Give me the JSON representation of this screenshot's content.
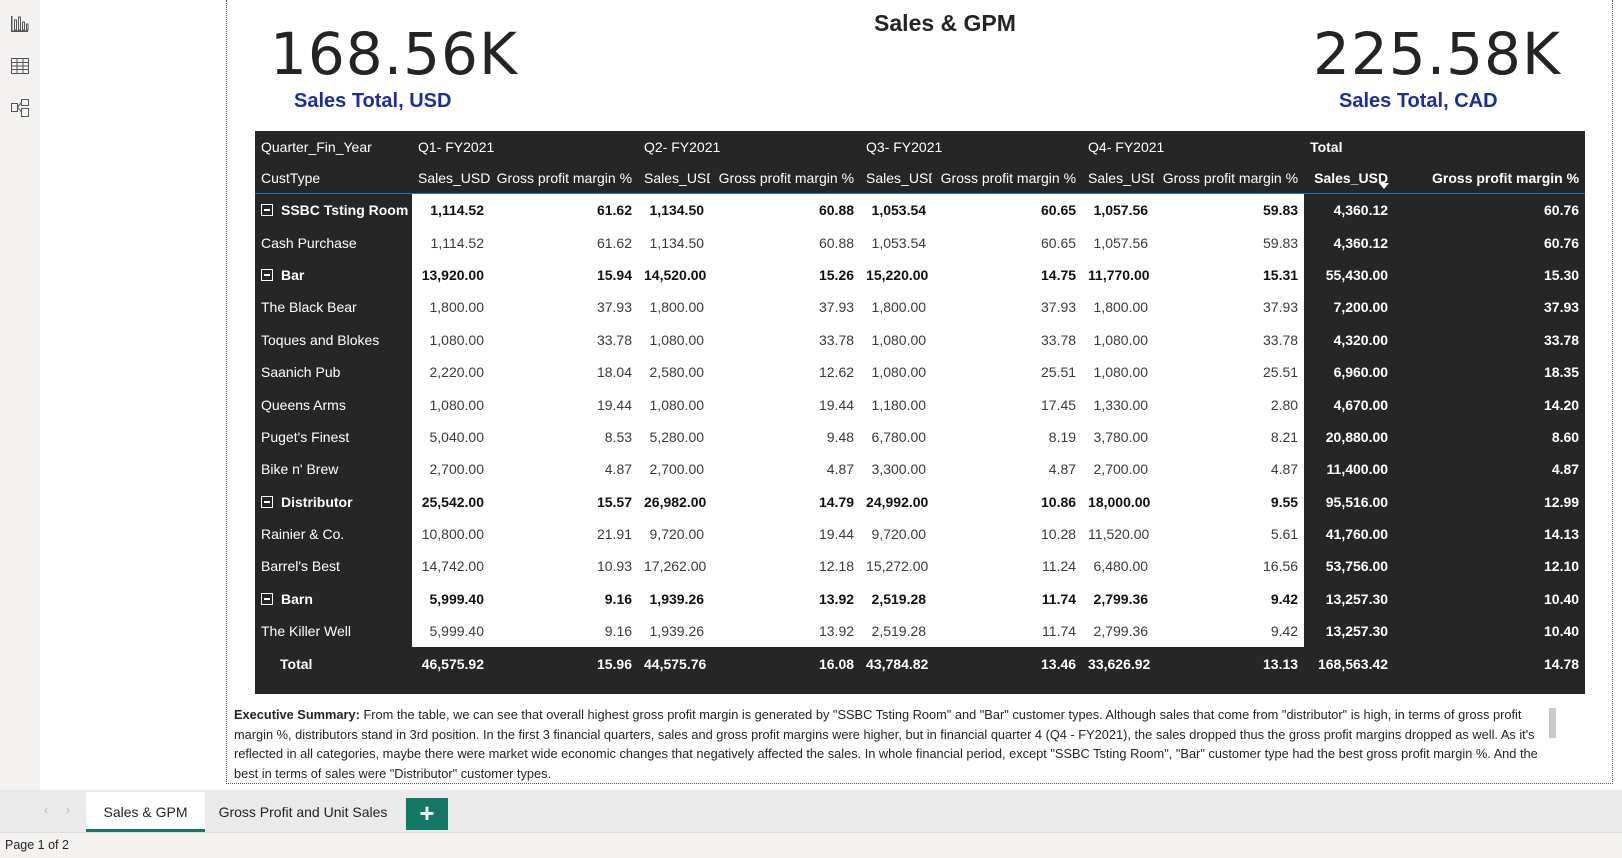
{
  "report": {
    "title": "Sales & GPM",
    "kpi_left": {
      "value": "168.56K",
      "label": "Sales Total, USD"
    },
    "kpi_right": {
      "value": "225.58K",
      "label": "Sales Total, CAD"
    }
  },
  "matrix": {
    "header_row1": {
      "corner": "Quarter_Fin_Year",
      "q1": "Q1- FY2021",
      "q2": "Q2- FY2021",
      "q3": "Q3- FY2021",
      "q4": "Q4- FY2021",
      "total": "Total"
    },
    "header_row2": {
      "corner": "CustType",
      "col_sales": "Sales_USD",
      "col_gpm": "Gross profit margin %"
    },
    "rows": [
      {
        "label": "SSBC Tsting Room",
        "level": "group",
        "vals": [
          "1,114.52",
          "61.62",
          "1,134.50",
          "60.88",
          "1,053.54",
          "60.65",
          "1,057.56",
          "59.83"
        ],
        "total": [
          "4,360.12",
          "60.76"
        ]
      },
      {
        "label": "Cash Purchase",
        "level": "child",
        "vals": [
          "1,114.52",
          "61.62",
          "1,134.50",
          "60.88",
          "1,053.54",
          "60.65",
          "1,057.56",
          "59.83"
        ],
        "total": [
          "4,360.12",
          "60.76"
        ]
      },
      {
        "label": "Bar",
        "level": "group",
        "vals": [
          "13,920.00",
          "15.94",
          "14,520.00",
          "15.26",
          "15,220.00",
          "14.75",
          "11,770.00",
          "15.31"
        ],
        "total": [
          "55,430.00",
          "15.30"
        ]
      },
      {
        "label": "The Black Bear",
        "level": "child",
        "vals": [
          "1,800.00",
          "37.93",
          "1,800.00",
          "37.93",
          "1,800.00",
          "37.93",
          "1,800.00",
          "37.93"
        ],
        "total": [
          "7,200.00",
          "37.93"
        ]
      },
      {
        "label": "Toques and Blokes",
        "level": "child",
        "vals": [
          "1,080.00",
          "33.78",
          "1,080.00",
          "33.78",
          "1,080.00",
          "33.78",
          "1,080.00",
          "33.78"
        ],
        "total": [
          "4,320.00",
          "33.78"
        ]
      },
      {
        "label": "Saanich Pub",
        "level": "child",
        "vals": [
          "2,220.00",
          "18.04",
          "2,580.00",
          "12.62",
          "1,080.00",
          "25.51",
          "1,080.00",
          "25.51"
        ],
        "total": [
          "6,960.00",
          "18.35"
        ]
      },
      {
        "label": "Queens Arms",
        "level": "child",
        "vals": [
          "1,080.00",
          "19.44",
          "1,080.00",
          "19.44",
          "1,180.00",
          "17.45",
          "1,330.00",
          "2.80"
        ],
        "total": [
          "4,670.00",
          "14.20"
        ]
      },
      {
        "label": "Puget's Finest",
        "level": "child",
        "vals": [
          "5,040.00",
          "8.53",
          "5,280.00",
          "9.48",
          "6,780.00",
          "8.19",
          "3,780.00",
          "8.21"
        ],
        "total": [
          "20,880.00",
          "8.60"
        ]
      },
      {
        "label": "Bike n' Brew",
        "level": "child",
        "vals": [
          "2,700.00",
          "4.87",
          "2,700.00",
          "4.87",
          "3,300.00",
          "4.87",
          "2,700.00",
          "4.87"
        ],
        "total": [
          "11,400.00",
          "4.87"
        ]
      },
      {
        "label": "Distributor",
        "level": "group",
        "vals": [
          "25,542.00",
          "15.57",
          "26,982.00",
          "14.79",
          "24,992.00",
          "10.86",
          "18,000.00",
          "9.55"
        ],
        "total": [
          "95,516.00",
          "12.99"
        ]
      },
      {
        "label": "Rainier & Co.",
        "level": "child",
        "vals": [
          "10,800.00",
          "21.91",
          "9,720.00",
          "19.44",
          "9,720.00",
          "10.28",
          "11,520.00",
          "5.61"
        ],
        "total": [
          "41,760.00",
          "14.13"
        ]
      },
      {
        "label": "Barrel's Best",
        "level": "child",
        "vals": [
          "14,742.00",
          "10.93",
          "17,262.00",
          "12.18",
          "15,272.00",
          "11.24",
          "6,480.00",
          "16.56"
        ],
        "total": [
          "53,756.00",
          "12.10"
        ]
      },
      {
        "label": "Barn",
        "level": "group",
        "vals": [
          "5,999.40",
          "9.16",
          "1,939.26",
          "13.92",
          "2,519.28",
          "11.74",
          "2,799.36",
          "9.42"
        ],
        "total": [
          "13,257.30",
          "10.40"
        ]
      },
      {
        "label": "The Killer Well",
        "level": "child",
        "vals": [
          "5,999.40",
          "9.16",
          "1,939.26",
          "13.92",
          "2,519.28",
          "11.74",
          "2,799.36",
          "9.42"
        ],
        "total": [
          "13,257.30",
          "10.40"
        ]
      }
    ],
    "grand_total": {
      "label": "Total",
      "vals": [
        "46,575.92",
        "15.96",
        "44,575.76",
        "16.08",
        "43,784.82",
        "13.46",
        "33,626.92",
        "13.13"
      ],
      "total": [
        "168,563.42",
        "14.78"
      ]
    }
  },
  "summary": {
    "heading": "Executive Summary:",
    "text": "From the table, we can see that overall highest gross profit margin is generated by \"SSBC Tsting Room\"  and \"Bar\" customer types. Although sales that come from \"distributor\" is high, in terms of gross profit margin %, distributors stand in 3rd position. In the first 3 financial quarters, sales and gross profit margins were higher, but in financial quarter 4 (Q4 - FY2021), the sales dropped thus the gross profit margins dropped as well. As it's reflected in all categories, maybe there were market wide economic changes that negatively affected the sales. In whole financial period, except \"SSBC Tsting Room\", \"Bar\" customer type had the best gross profit margin %. And the best in terms of sales were \"Distributor\" customer types."
  },
  "tabs": {
    "active": "Sales & GPM",
    "second": "Gross Profit and Unit Sales",
    "add": "+",
    "prev": "‹",
    "next": "›"
  },
  "status": {
    "page": "Page 1 of 2"
  },
  "icons": {
    "rail": [
      "report-view-icon",
      "table-view-icon",
      "model-view-icon"
    ]
  },
  "colors": {
    "accent_green": "#117865",
    "kpi_label": "#1a2f9a",
    "matrix_bg": "#262626"
  }
}
